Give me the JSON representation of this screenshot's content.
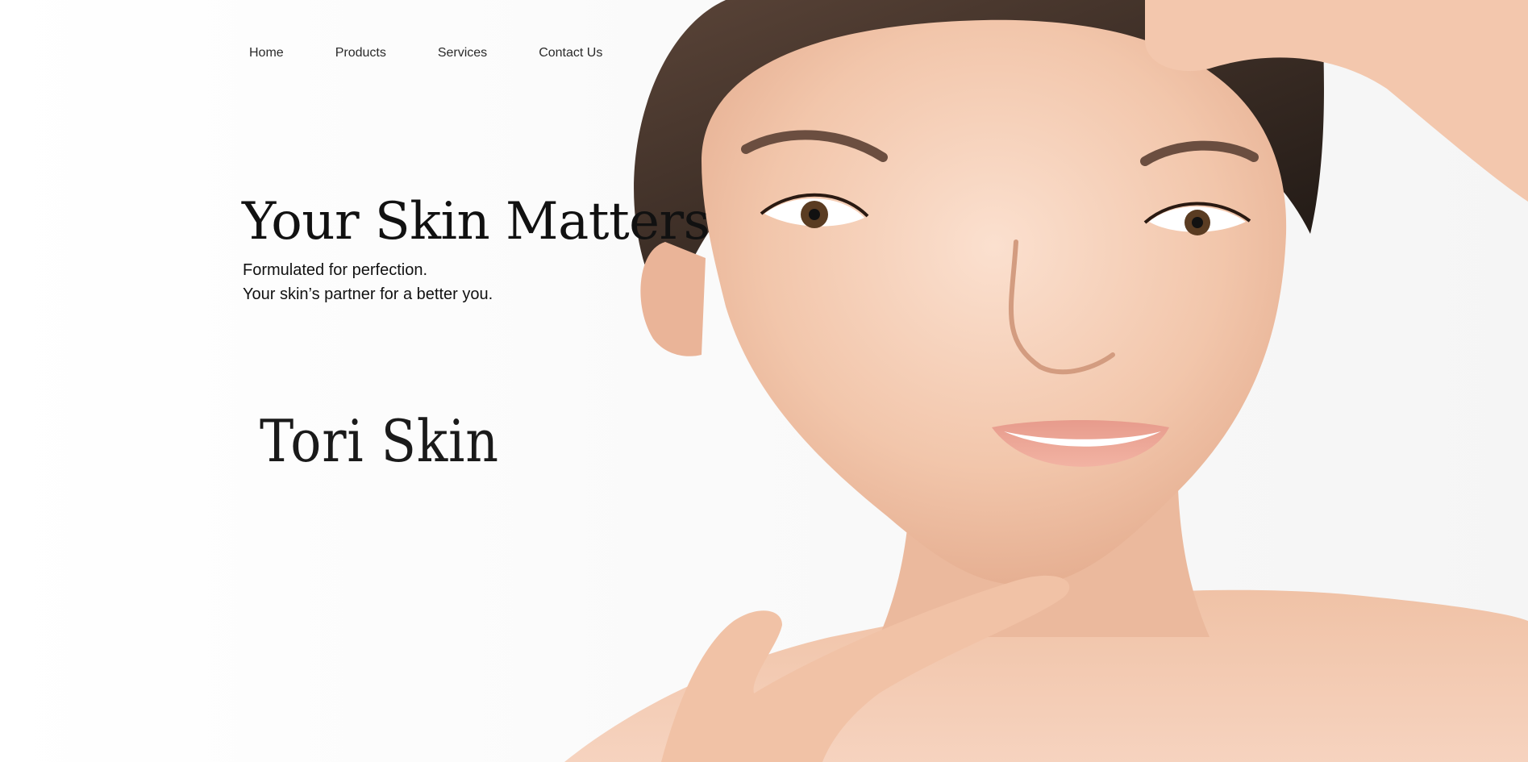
{
  "nav": {
    "items": [
      {
        "label": "Home"
      },
      {
        "label": "Products"
      },
      {
        "label": "Services"
      },
      {
        "label": "Contact Us"
      }
    ]
  },
  "hero": {
    "title": "Your Skin Matters",
    "subtitle_line1": "Formulated for perfection.",
    "subtitle_line2": "Your skin’s partner for a better you."
  },
  "brand": {
    "name": "Tori Skin"
  },
  "colors": {
    "background": "#ffffff",
    "text": "#111111",
    "skin": "#f2c9b0",
    "hair": "#2e2420"
  }
}
